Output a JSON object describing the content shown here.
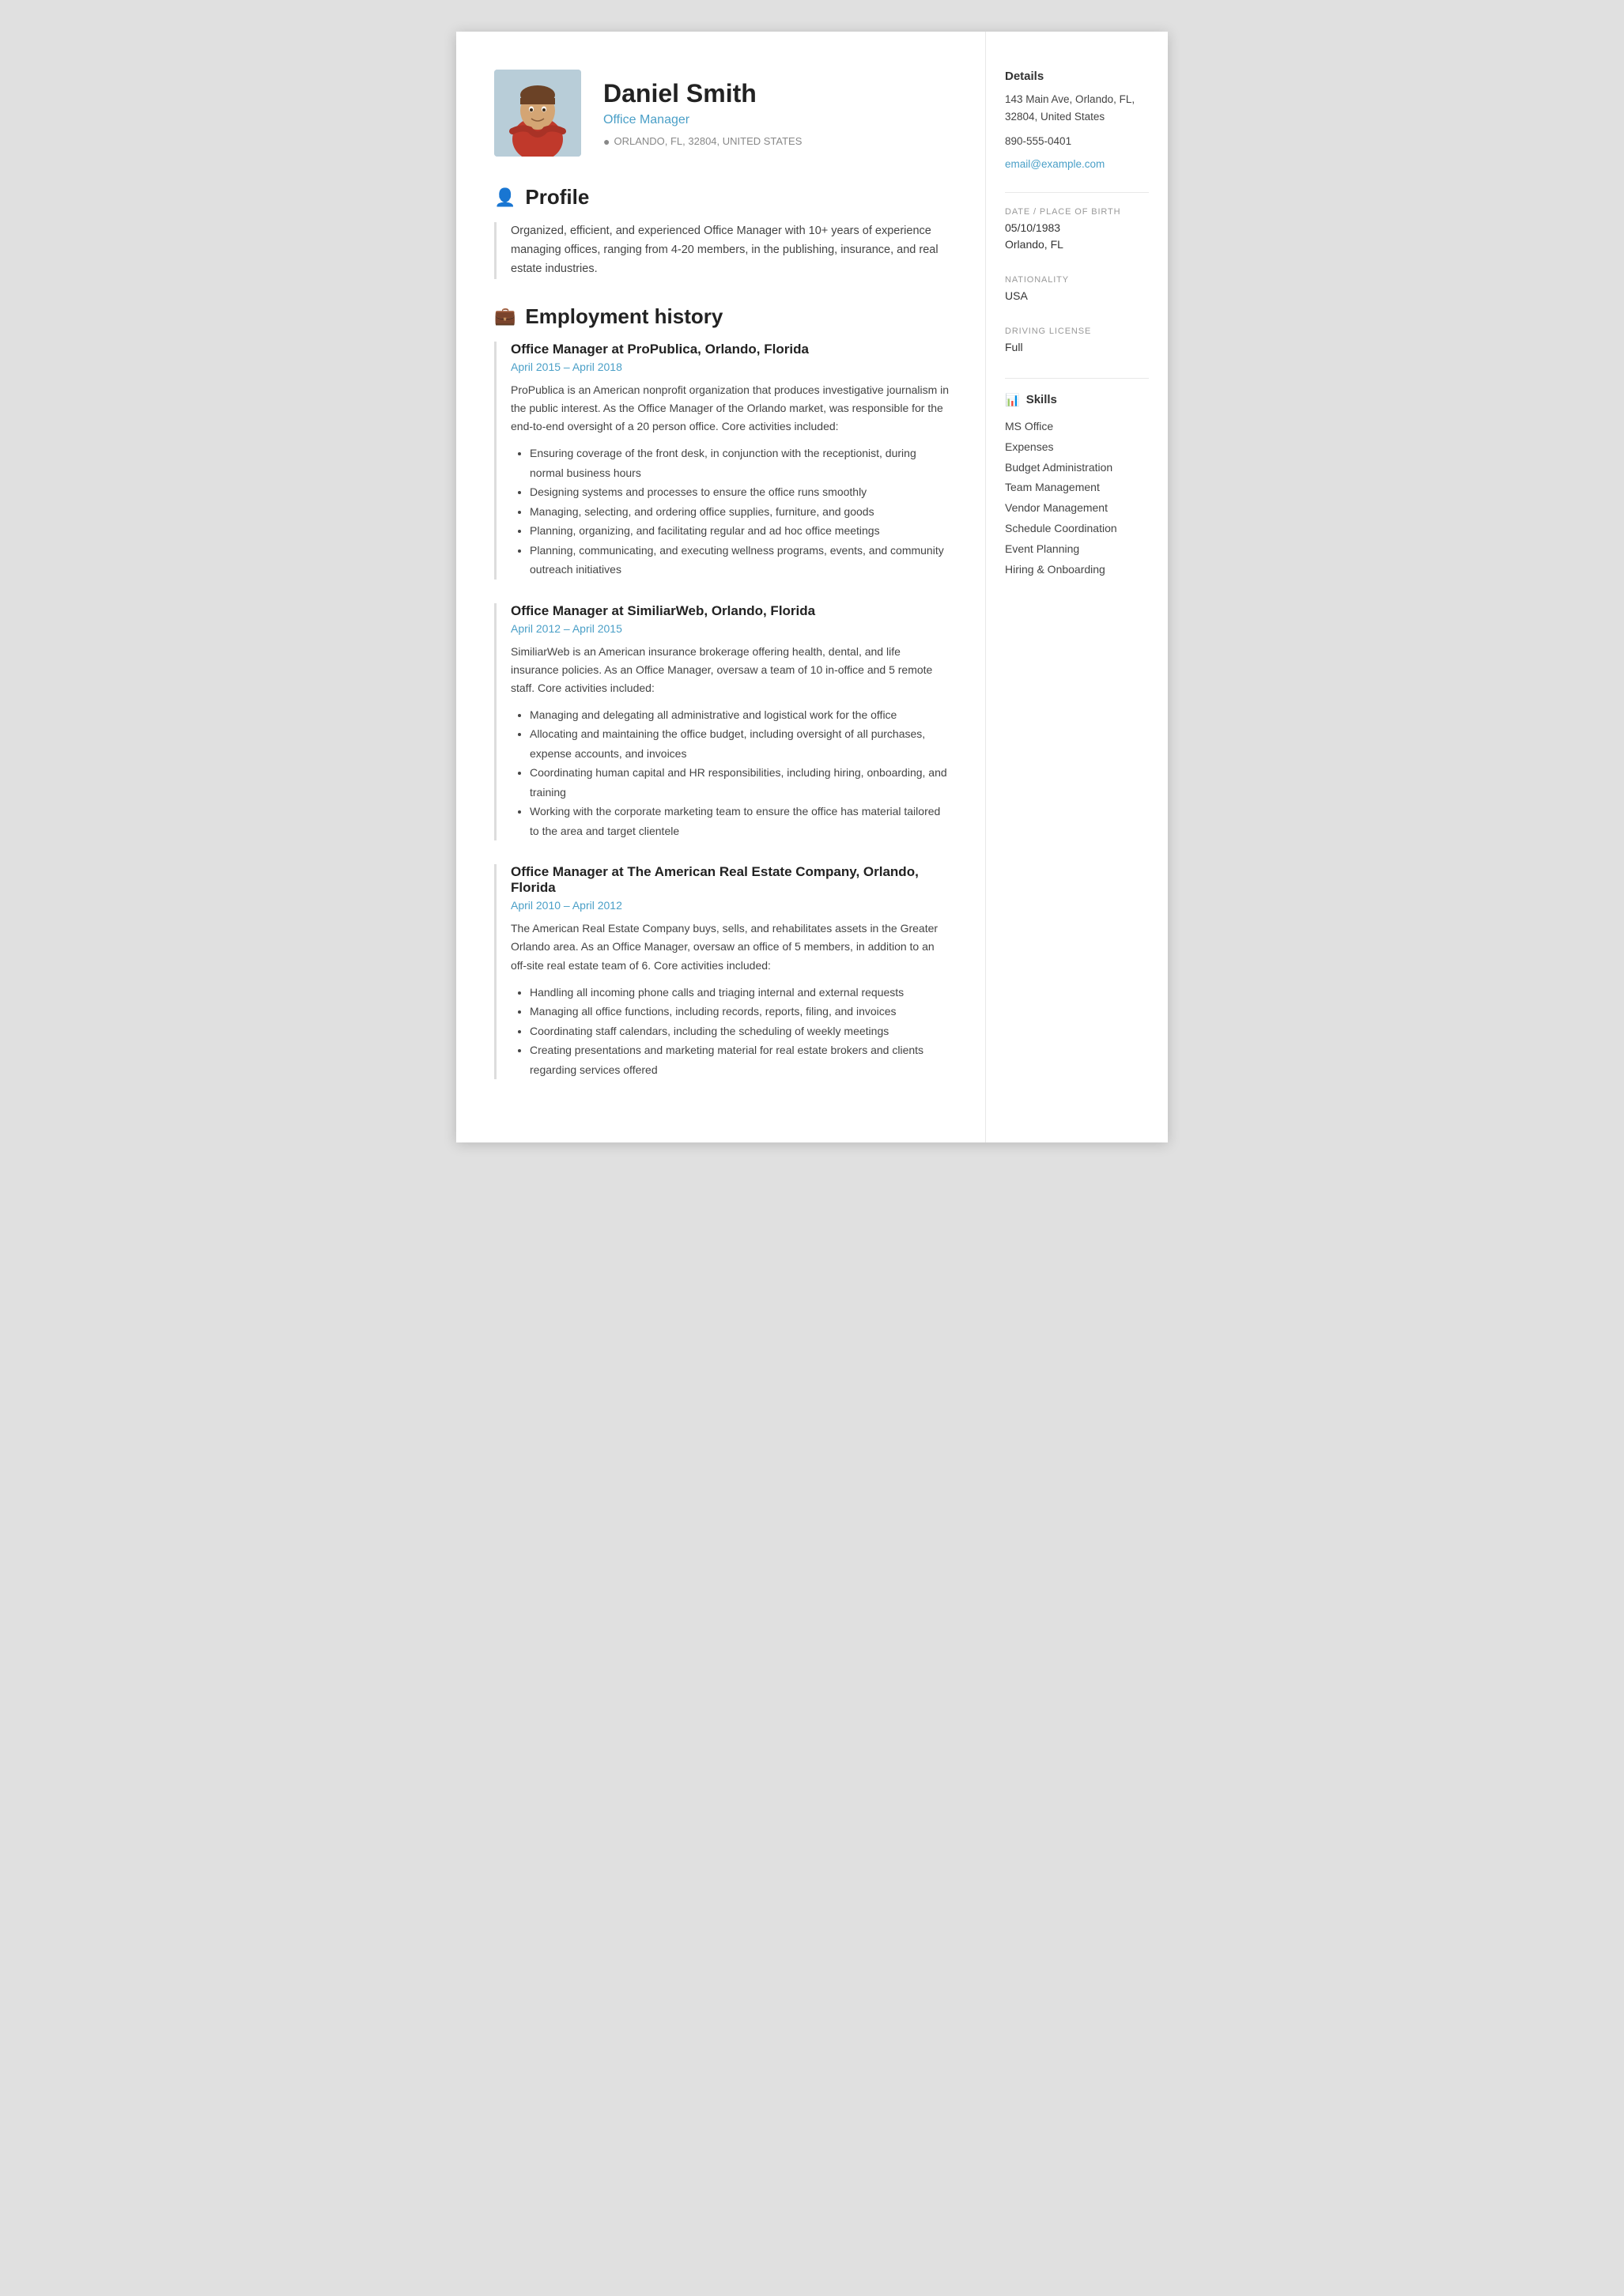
{
  "header": {
    "name": "Daniel Smith",
    "job_title": "Office Manager",
    "location": "ORLANDO, FL, 32804, UNITED STATES"
  },
  "profile": {
    "section_label": "Profile",
    "text": "Organized, efficient, and experienced Office Manager with 10+ years of experience managing offices, ranging from 4-20 members, in the publishing, insurance, and real estate industries."
  },
  "employment": {
    "section_label": "Employment history",
    "jobs": [
      {
        "title": "Office Manager at ProPublica, Orlando, Florida",
        "dates": "April 2015  –  April 2018",
        "description": "ProPublica is an American nonprofit organization that produces investigative journalism in the public interest. As the Office Manager of the Orlando market, was responsible for the end-to-end oversight of a 20 person office. Core activities included:",
        "bullets": [
          "Ensuring coverage of the front desk, in conjunction with the receptionist, during normal business hours",
          "Designing systems and processes to ensure the office runs smoothly",
          "Managing, selecting, and ordering office supplies, furniture, and goods",
          "Planning, organizing, and facilitating regular and ad hoc office meetings",
          "Planning, communicating, and executing wellness programs, events, and community outreach initiatives"
        ]
      },
      {
        "title": "Office Manager at SimiliarWeb, Orlando, Florida",
        "dates": "April 2012  –  April 2015",
        "description": "SimiliarWeb is an American insurance brokerage offering health, dental, and life insurance policies. As an Office Manager, oversaw a team of 10 in-office and 5 remote staff. Core activities included:",
        "bullets": [
          "Managing and delegating all administrative and logistical work for the office",
          "Allocating and maintaining the office budget, including oversight of all purchases, expense accounts, and invoices",
          "Coordinating human capital and HR responsibilities, including hiring, onboarding, and training",
          "Working with the corporate marketing team to ensure the office has material tailored to the area and target clientele"
        ]
      },
      {
        "title": "Office Manager at The American Real Estate Company, Orlando, Florida",
        "dates": "April 2010  –  April 2012",
        "description": "The American Real Estate Company buys, sells, and rehabilitates assets in the Greater Orlando area. As an Office Manager, oversaw an office of 5 members, in addition to an off-site real estate team of 6. Core activities included:",
        "bullets": [
          "Handling all incoming phone calls and triaging internal and external requests",
          "Managing all office functions, including records, reports, filing, and invoices",
          "Coordinating staff calendars, including the scheduling of weekly meetings",
          "Creating presentations and marketing material for real estate brokers and clients regarding services offered"
        ]
      }
    ]
  },
  "sidebar": {
    "details_label": "Details",
    "address": "143 Main Ave, Orlando, FL, 32804, United States",
    "phone": "890-555-0401",
    "email": "email@example.com",
    "dob_label": "DATE / PLACE OF BIRTH",
    "dob": "05/10/1983",
    "dob_place": "Orlando, FL",
    "nationality_label": "NATIONALITY",
    "nationality": "USA",
    "driving_label": "DRIVING LICENSE",
    "driving": "Full",
    "skills_label": "Skills",
    "skills": [
      "MS Office",
      "Expenses",
      "Budget Administration",
      "Team Management",
      "Vendor Management",
      "Schedule Coordination",
      "Event Planning",
      "Hiring & Onboarding"
    ]
  }
}
